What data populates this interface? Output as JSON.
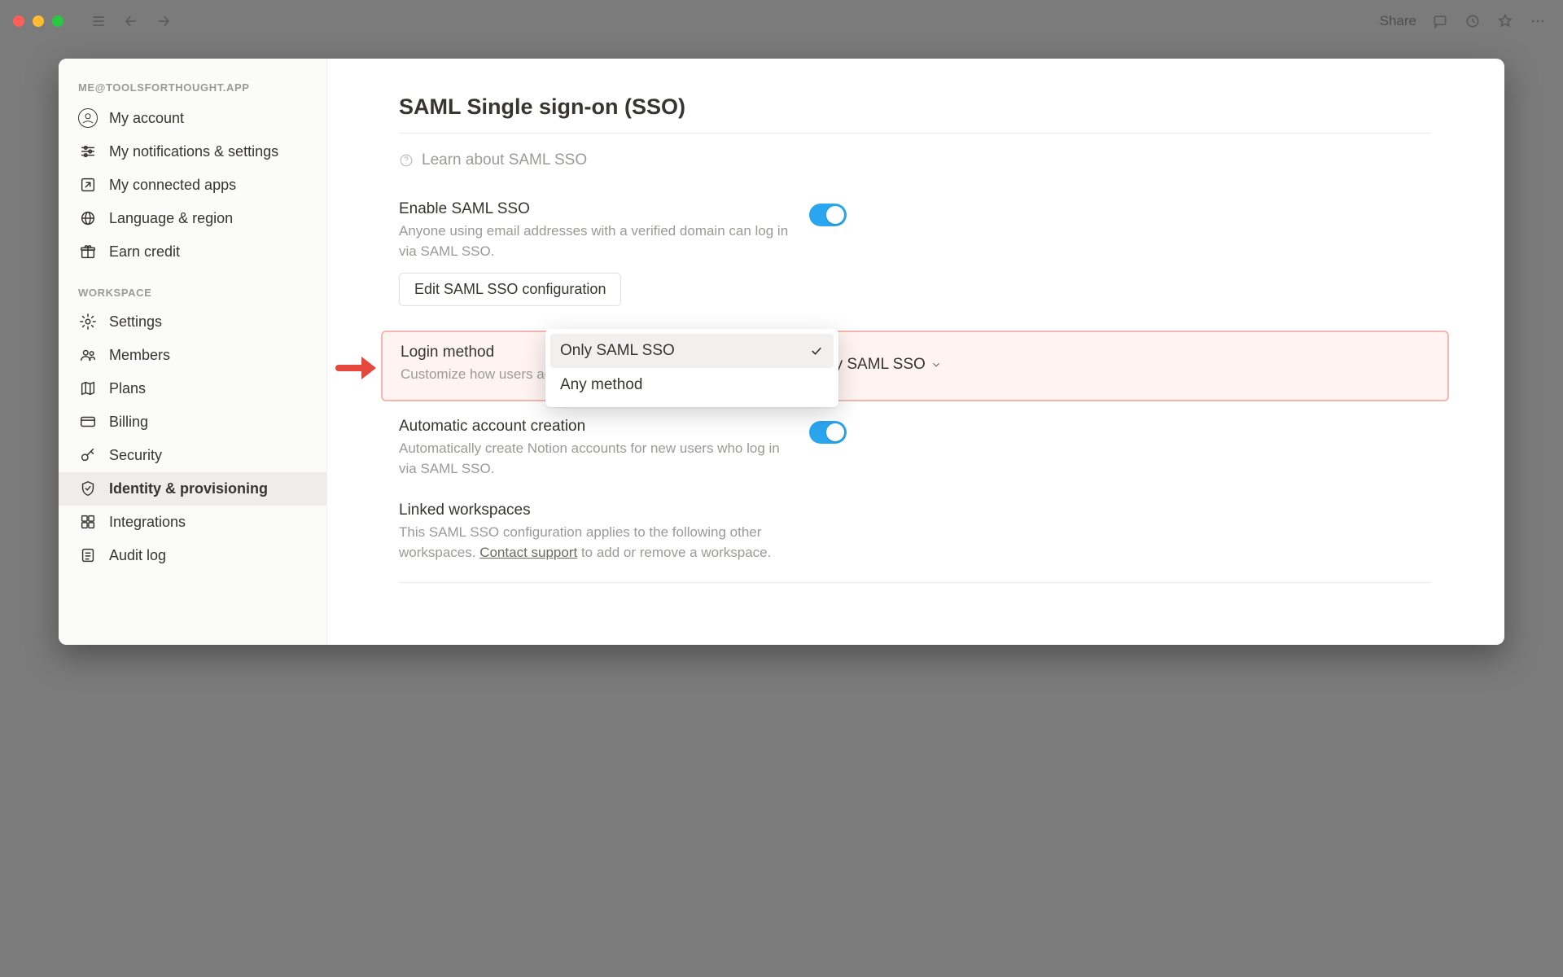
{
  "chrome": {
    "share_label": "Share"
  },
  "sidebar": {
    "account_email": "ME@TOOLSFORTHOUGHT.APP",
    "workspace_label": "WORKSPACE",
    "personal": [
      {
        "label": "My account"
      },
      {
        "label": "My notifications & settings"
      },
      {
        "label": "My connected apps"
      },
      {
        "label": "Language & region"
      },
      {
        "label": "Earn credit"
      }
    ],
    "workspace": [
      {
        "label": "Settings"
      },
      {
        "label": "Members"
      },
      {
        "label": "Plans"
      },
      {
        "label": "Billing"
      },
      {
        "label": "Security"
      },
      {
        "label": "Identity & provisioning"
      },
      {
        "label": "Integrations"
      },
      {
        "label": "Audit log"
      }
    ]
  },
  "page": {
    "title": "SAML Single sign-on (SSO)",
    "learn_label": "Learn about SAML SSO",
    "enable": {
      "title": "Enable SAML SSO",
      "desc": "Anyone using email addresses with a verified domain can log in via SAML SSO.",
      "button": "Edit SAML SSO configuration"
    },
    "login_method": {
      "title": "Login method",
      "desc": "Customize how users access workspaces.",
      "selected": "Only SAML SSO",
      "options": [
        "Only SAML SSO",
        "Any method"
      ]
    },
    "auto_create": {
      "title": "Automatic account creation",
      "desc": "Automatically create Notion accounts for new users who log in via SAML SSO."
    },
    "linked": {
      "title": "Linked workspaces",
      "desc_pre": "This SAML SSO configuration applies to the following other workspaces. ",
      "desc_link": "Contact support",
      "desc_post": " to add or remove a workspace."
    }
  }
}
